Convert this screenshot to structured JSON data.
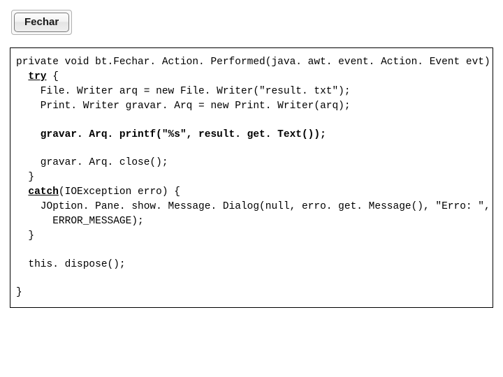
{
  "button": {
    "label": "Fechar"
  },
  "code": {
    "l1a": "private void bt.Fechar. Action. Performed(java. awt. event. Action. Event evt) {",
    "try_kw": "try",
    "l2b": " {",
    "l3": "    File. Writer arq = new File. Writer(\"result. txt\");",
    "l4": "    Print. Writer gravar. Arq = new Print. Writer(arq);",
    "l5": "    gravar. Arq. printf(\"%s\", result. get. Text());",
    "l6": "    gravar. Arq. close();",
    "l7": "  }",
    "catch_kw": "catch",
    "l8b": "(IOException erro) {",
    "l9": "    JOption. Pane. show. Message. Dialog(null, erro. get. Message(), \"Erro: \",",
    "l10": "      ERROR_MESSAGE);",
    "l11": "  }",
    "l12": "  this. dispose();",
    "l13": "}"
  }
}
